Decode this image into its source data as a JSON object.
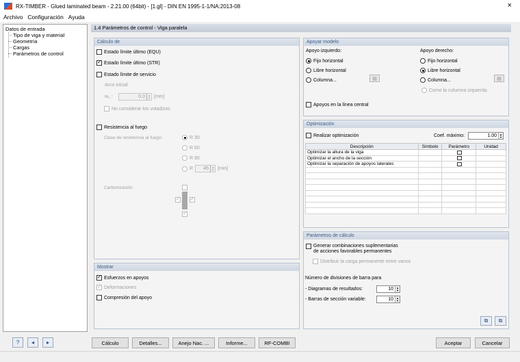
{
  "window": {
    "title": "RX-TIMBER - Glued laminated beam - 2.21.00 (64bit) - [1.gl] - DIN EN 1995-1-1/NA:2013-08",
    "close": "×"
  },
  "menu": [
    "Archivo",
    "Configuración",
    "Ayuda"
  ],
  "nav": {
    "root": "Datos de entrada",
    "items": [
      "Tipo de viga y material",
      "Geometría",
      "Cargas",
      "Parámetros de control"
    ]
  },
  "header": "1.4 Parámetros de control  -  Viga paralela",
  "calculo": {
    "title": "Cálculo de",
    "equ": "Estado límite último (EQU)",
    "str": "Estado límite último (STR)",
    "servicio": "Estado límite de servicio",
    "arco_inicial": "Arco inicial",
    "w0_label": "w₀ :",
    "w0_value": "0.0",
    "w0_unit": "[mm]",
    "voladizos": "No considerar los voladizos",
    "fuego": "Resistencia al fuego",
    "clase_label": "Clase de resistencia al fuego:",
    "r30": "R 30",
    "r60": "R 60",
    "r90": "R 90",
    "r_label": "R",
    "r_value": "45",
    "r_unit": "[min]",
    "carbonizacion": "Carbonización:"
  },
  "mostrar": {
    "title": "Mostrar",
    "esfuerzos": "Esfuerzos en apoyos",
    "deformaciones": "Deformaciones",
    "compresion": "Compresión del apoyo"
  },
  "apoyar": {
    "title": "Apoyar modelo",
    "izq_label": "Apoyo izquierdo:",
    "der_label": "Apoyo derecho:",
    "fijo": "Fijo horizontal",
    "libre": "Libre horizontal",
    "columna": "Columna...",
    "como_izq": "Como la columna izquierda",
    "linea_central": "Apoyos en la línea central"
  },
  "optimizacion": {
    "title": "Optimización",
    "realizar": "Realizar optimización",
    "coef_label": "Coef. máximo:",
    "coef_value": "1.00",
    "columns": [
      "Descripción",
      "Símbolo",
      "Parámetro",
      "Unidad"
    ],
    "rows": [
      "Optimizar la altura de la viga",
      "Optimizar el ancho de la sección",
      "Optimizar la separación de apoyos laterales"
    ]
  },
  "parametros": {
    "title": "Parámetros de cálculo",
    "generar_1": "Generar combinaciones suplementarias",
    "generar_2": "de acciones favorables permanentes",
    "distribuir": "Distribuir la carga permanente entre vanos",
    "divisiones": "Número de divisiones de barra para",
    "diagramas": "- Diagramas de resultados:",
    "diagramas_value": "10",
    "barras": "- Barras de sección variable:",
    "barras_value": "10"
  },
  "buttons": {
    "calculo": "Cálculo",
    "detalles": "Detalles...",
    "anejo": "Anejo Nac. ...",
    "informe": "Informe...",
    "rfcombi": "RF-COMBI",
    "aceptar": "Aceptar",
    "cancelar": "Cancelar"
  }
}
